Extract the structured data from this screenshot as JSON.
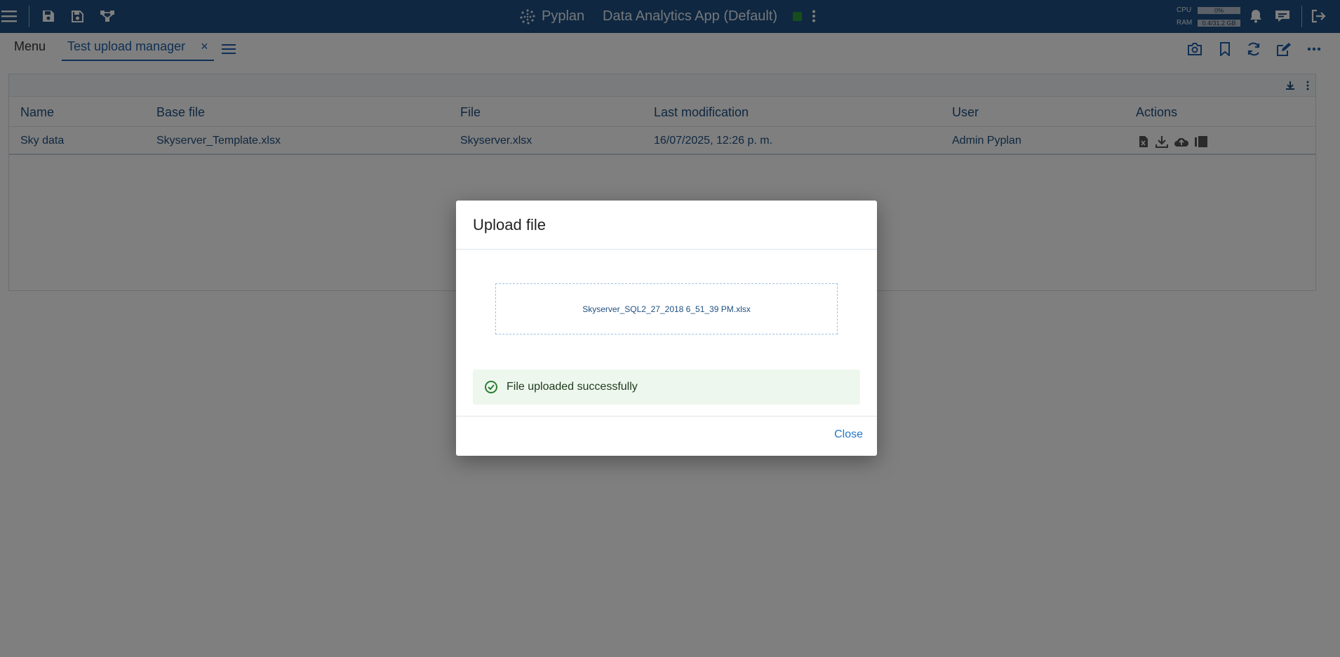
{
  "topbar": {
    "brand": "Pyplan",
    "app_title": "Data Analytics App (Default)",
    "cpu_label": "CPU",
    "cpu_value": "0%",
    "ram_label": "RAM",
    "ram_value": "0.4/31.2 GB",
    "status_color": "#2e9a3a"
  },
  "tabs": {
    "menu_label": "Menu",
    "active_label": "Test upload manager",
    "close_glyph": "×"
  },
  "table": {
    "headers": [
      "Name",
      "Base file",
      "File",
      "Last modification",
      "User",
      "Actions"
    ],
    "rows": [
      {
        "name": "Sky data",
        "base_file": "Skyserver_Template.xlsx",
        "file": "Skyserver.xlsx",
        "last_modification": "16/07/2025, 12:26 p. m.",
        "user": "Admin Pyplan",
        "actions": [
          "excel-file-icon",
          "download-icon",
          "cloud-upload-icon",
          "compare-icon"
        ]
      }
    ]
  },
  "dialog": {
    "title": "Upload file",
    "file_name": "Skyserver_SQL2_27_2018 6_51_39 PM.xlsx",
    "success_message": "File uploaded successfully",
    "close_label": "Close"
  },
  "colors": {
    "topbar_bg": "#1e4f80",
    "accent": "#1e5fa8",
    "success_bg": "#edf7ed",
    "success_icon": "#2e7d32"
  }
}
